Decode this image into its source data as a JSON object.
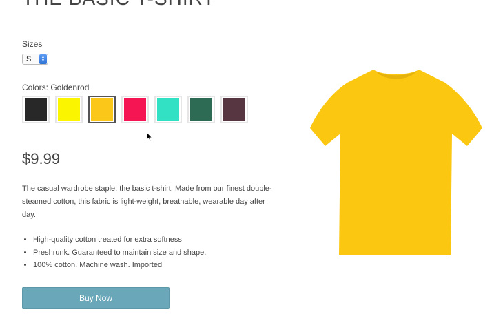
{
  "product": {
    "title": "THE BASIC T-SHIRT",
    "sizes_label": "Sizes",
    "selected_size": "S",
    "colors_label": "Colors: Goldenrod",
    "swatches": [
      {
        "name": "Black",
        "color": "#282828",
        "selected": false
      },
      {
        "name": "Yellow",
        "color": "#fbf500",
        "selected": false
      },
      {
        "name": "Goldenrod",
        "color": "#fbc718",
        "selected": true
      },
      {
        "name": "Crimson",
        "color": "#f41552",
        "selected": false
      },
      {
        "name": "Turquoise",
        "color": "#32e1c3",
        "selected": false
      },
      {
        "name": "Green",
        "color": "#2d6b55",
        "selected": false
      },
      {
        "name": "Plum",
        "color": "#573642",
        "selected": false
      }
    ],
    "price": "$9.99",
    "description": "The casual wardrobe staple: the basic t-shirt. Made from our finest double-steamed cotton, this fabric is light-weight, breathable, wearable day after day.",
    "features": [
      "High-quality cotton treated for extra softness",
      "Preshrunk. Guaranteed to maintain size and shape.",
      "100% cotton. Machine wash. Imported"
    ],
    "buy_label": "Buy Now",
    "shirt_color": "#fbc711"
  }
}
